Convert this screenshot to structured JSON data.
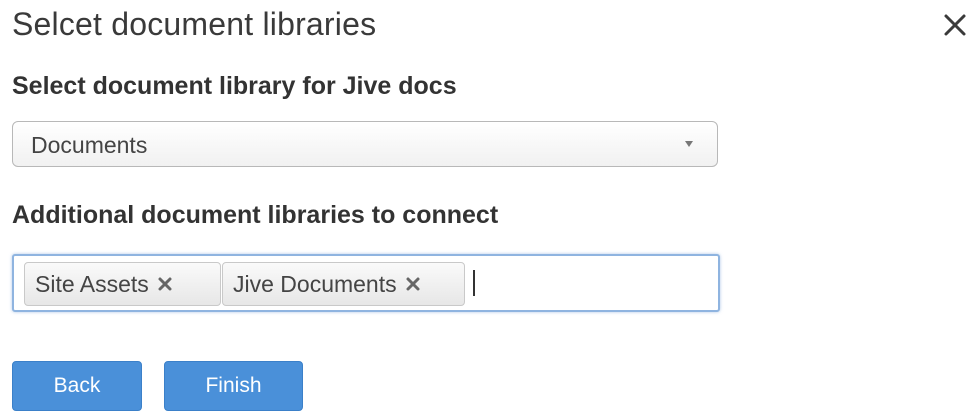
{
  "dialog": {
    "title": "Selcet document libraries",
    "close_icon": "close-icon"
  },
  "primary_library": {
    "label": "Select document library for Jive docs",
    "selected_value": "Documents",
    "caret_icon": "chevron-down-icon"
  },
  "additional_libraries": {
    "label": "Additional document libraries to connect",
    "tags": [
      {
        "label": "Site Assets",
        "remove_icon": "close-icon"
      },
      {
        "label": "Jive Documents",
        "remove_icon": "close-icon"
      }
    ],
    "input_value": ""
  },
  "actions": {
    "back_label": "Back",
    "finish_label": "Finish"
  },
  "colors": {
    "button_blue": "#4a90d9",
    "focus_border": "#8fb4e0",
    "text_dark": "#333333"
  }
}
